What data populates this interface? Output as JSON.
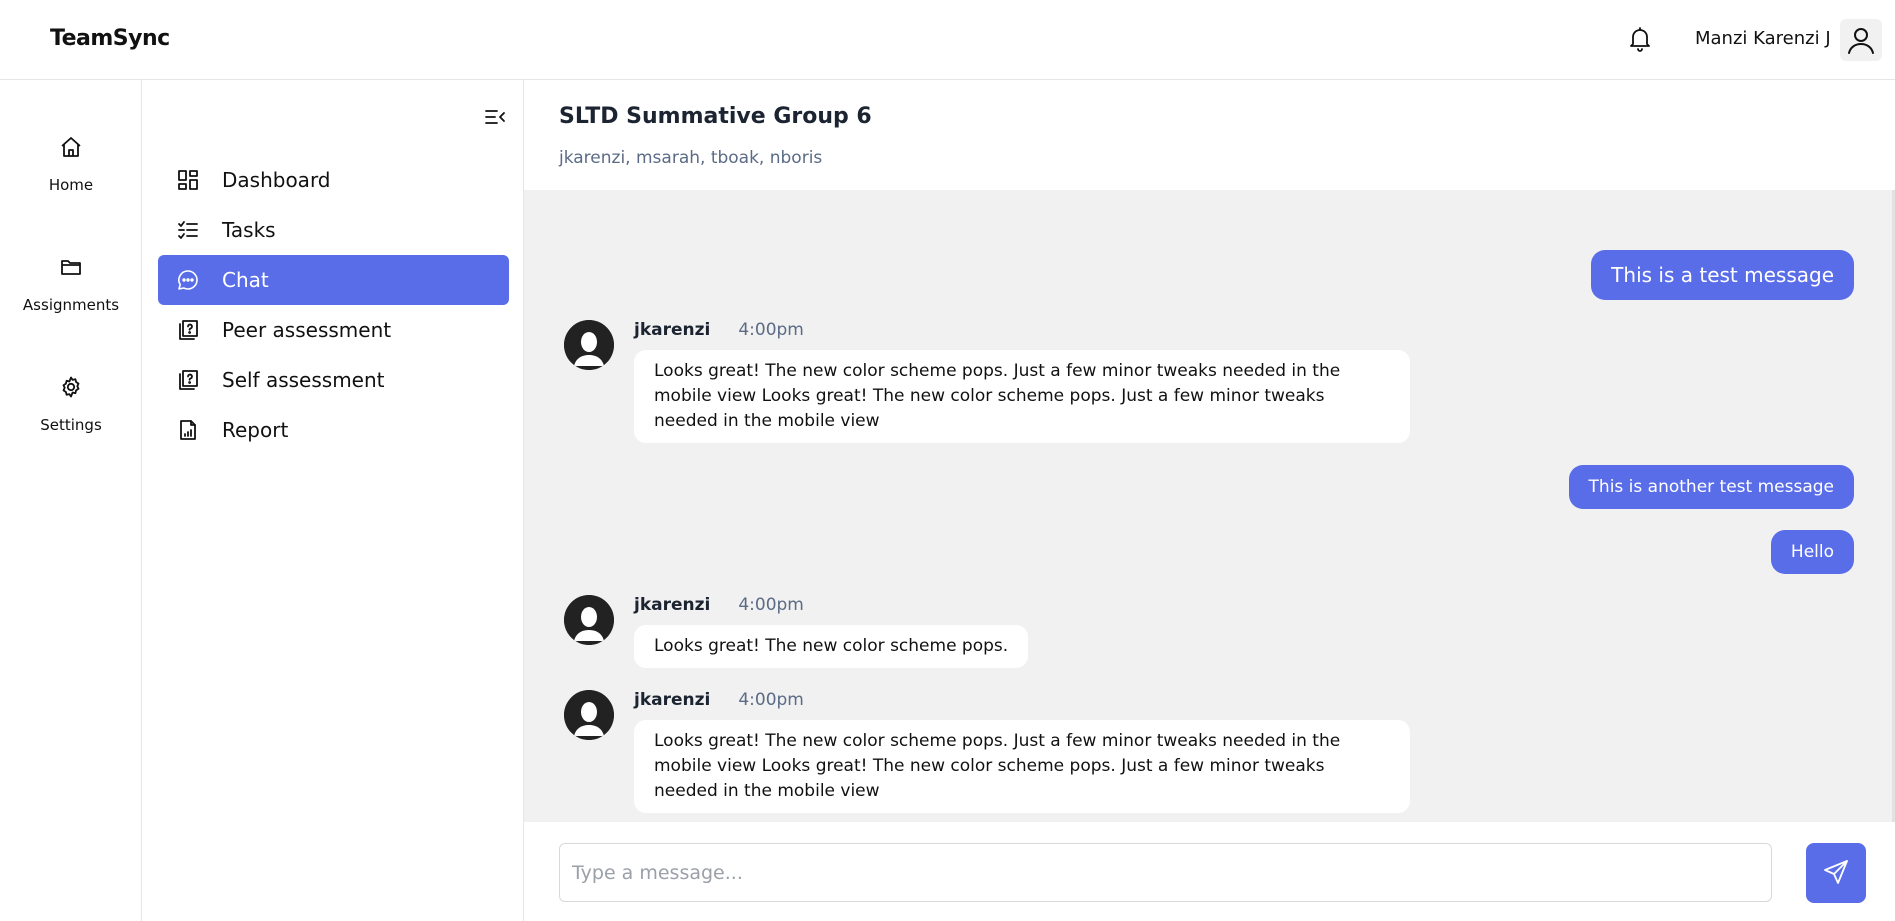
{
  "app": {
    "name": "TeamSync"
  },
  "header": {
    "user_name": "Manzi Karenzi J"
  },
  "rail": {
    "items": [
      {
        "label": "Home",
        "icon": "home-icon"
      },
      {
        "label": "Assignments",
        "icon": "folder-icon"
      },
      {
        "label": "Settings",
        "icon": "gear-icon"
      }
    ]
  },
  "subnav": {
    "items": [
      {
        "label": "Dashboard",
        "icon": "dashboard-icon",
        "active": false
      },
      {
        "label": "Tasks",
        "icon": "checklist-icon",
        "active": false
      },
      {
        "label": "Chat",
        "icon": "chat-icon",
        "active": true
      },
      {
        "label": "Peer assessment",
        "icon": "question-book-icon",
        "active": false
      },
      {
        "label": "Self assessment",
        "icon": "question-book-icon",
        "active": false
      },
      {
        "label": "Report",
        "icon": "report-icon",
        "active": false
      }
    ]
  },
  "chat": {
    "title": "SLTD Summative Group 6",
    "members": "jkarenzi, msarah, tboak, nboris",
    "messages": [
      {
        "direction": "out",
        "text": "This is a test message"
      },
      {
        "direction": "in",
        "user": "jkarenzi",
        "time": "4:00pm",
        "text": "Looks great! The new color scheme pops. Just a few minor tweaks needed in the mobile view Looks great! The new color scheme pops. Just a few minor tweaks needed in the mobile view"
      },
      {
        "direction": "out",
        "text": "This is another test message"
      },
      {
        "direction": "out",
        "text": "Hello"
      },
      {
        "direction": "in",
        "user": "jkarenzi",
        "time": "4:00pm",
        "text": "Looks great! The new color scheme pops."
      },
      {
        "direction": "in",
        "user": "jkarenzi",
        "time": "4:00pm",
        "text": "Looks great! The new color scheme pops. Just a few minor tweaks needed in the mobile view Looks great! The new color scheme pops. Just a few minor tweaks needed in the mobile view"
      }
    ]
  },
  "composer": {
    "placeholder": "Type a message...",
    "value": ""
  },
  "colors": {
    "accent": "#5a6de9",
    "chat_background": "#f1f1f1",
    "muted_text": "#5b6b85"
  }
}
